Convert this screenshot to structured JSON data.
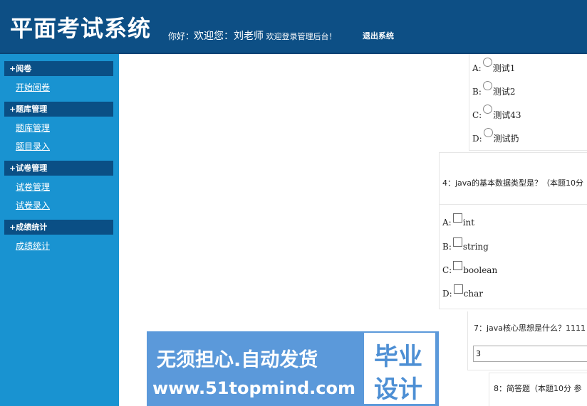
{
  "header": {
    "title": "平面考试系统",
    "greeting_prefix": "你好：",
    "greeting_name": "欢迎您：刘老师",
    "greeting_suffix": " 欢迎登录管理后台！",
    "logout": "退出系统"
  },
  "sidebar": {
    "sections": [
      {
        "title": "+阅卷",
        "items": [
          "开始阅卷"
        ]
      },
      {
        "title": "+题库管理",
        "items": [
          "题库管理",
          "题目录入"
        ]
      },
      {
        "title": "+试卷管理",
        "items": [
          "试卷管理",
          "试卷录入"
        ]
      },
      {
        "title": "+成绩统计",
        "items": [
          "成绩统计"
        ]
      }
    ]
  },
  "main": {
    "q3_options": [
      {
        "letter": "A:",
        "text": "测试1"
      },
      {
        "letter": "B:",
        "text": "测试2"
      },
      {
        "letter": "C:",
        "text": "测试43"
      },
      {
        "letter": "D:",
        "text": "测试扔"
      }
    ],
    "q4": {
      "title": "4：java的基本数据类型是？（本题10分",
      "options": [
        {
          "letter": "A:",
          "text": "int"
        },
        {
          "letter": "B:",
          "text": "string"
        },
        {
          "letter": "C:",
          "text": "boolean"
        },
        {
          "letter": "D:",
          "text": "char"
        }
      ]
    },
    "q7": {
      "title": "7：java核心思想是什么？1111",
      "answer": "3"
    },
    "q8": {
      "title": "8：简答题（本题10分 参"
    }
  },
  "watermark": {
    "line1": "无须担心.自动发货",
    "line2": "www.51topmind.com",
    "badge_top": "毕业",
    "badge_bottom": "设计"
  }
}
